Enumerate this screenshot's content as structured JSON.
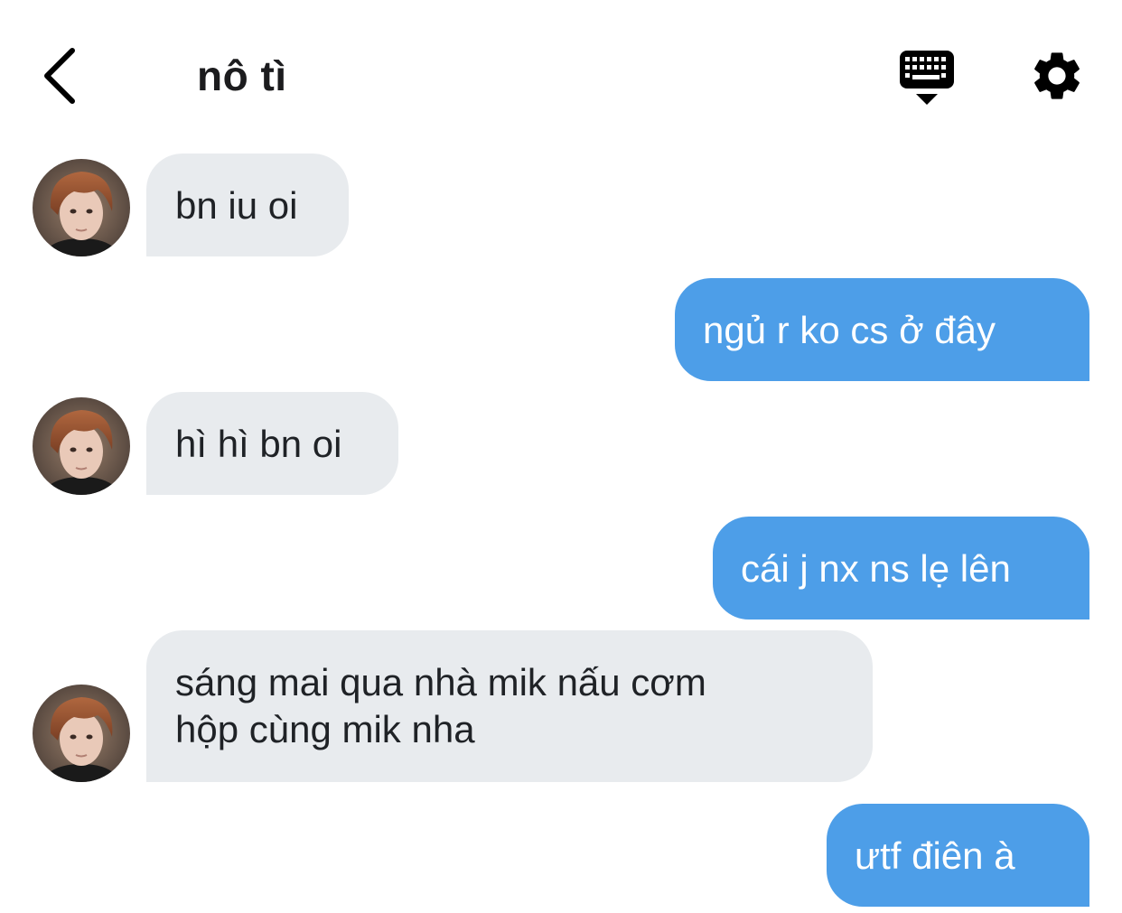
{
  "header": {
    "title": "nô tì",
    "icons": {
      "back": "chevron-left-icon",
      "keyboard": "keyboard-icon",
      "settings": "gear-icon"
    }
  },
  "colors": {
    "incoming_bubble": "#e8ebee",
    "outgoing_bubble": "#4d9ee8",
    "incoming_text": "#1f2226",
    "outgoing_text": "#ffffff"
  },
  "messages": [
    {
      "direction": "incoming",
      "text": "bn iu oi"
    },
    {
      "direction": "outgoing",
      "text": "ngủ r ko cs ở đây"
    },
    {
      "direction": "incoming",
      "text": "hì hì bn oi"
    },
    {
      "direction": "outgoing",
      "text": "cái j nx ns lẹ lên"
    },
    {
      "direction": "incoming",
      "lines": [
        "sáng mai qua nhà mik nấu cơm",
        "hộp cùng mik nha"
      ]
    },
    {
      "direction": "outgoing",
      "text": "ưtf điên à"
    }
  ]
}
